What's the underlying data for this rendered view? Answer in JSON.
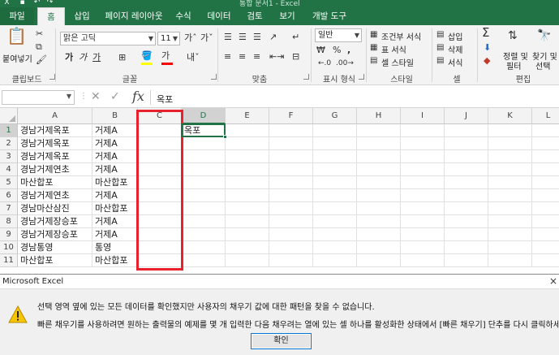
{
  "window": {
    "title": "통합 문서1 - Excel"
  },
  "tabs": [
    "파일",
    "홈",
    "삽입",
    "페이지 레이아웃",
    "수식",
    "데이터",
    "검토",
    "보기",
    "개발 도구"
  ],
  "ribbon": {
    "clipboard": {
      "paste_label": "붙여넣기",
      "group": "클립보드"
    },
    "font": {
      "name": "맑은 고딕",
      "size": "11",
      "bold": "가",
      "italic": "가",
      "underline": "가",
      "font_color": "가",
      "group": "글꼴",
      "fill_color": "#ffff00",
      "text_color": "#ff0000"
    },
    "alignment": {
      "group": "맞춤"
    },
    "number": {
      "format": "일반",
      "percent": "%",
      "comma": ",",
      "group": "표시 형식"
    },
    "styles": {
      "conditional": "조건부 서식",
      "table": "표 서식",
      "cell": "셀 스타일",
      "group": "스타일"
    },
    "cells": {
      "insert": "삽입",
      "delete": "삭제",
      "format": "서식",
      "group": "셀"
    },
    "editing": {
      "sum": "Σ",
      "sort": "정렬 및",
      "sort2": "필터",
      "find": "찾기 및",
      "find2": "선택",
      "group": "편집"
    }
  },
  "formula_bar": {
    "name_box": "",
    "fx": "fx",
    "value": "옥포"
  },
  "grid": {
    "columns": [
      "A",
      "B",
      "C",
      "D",
      "E",
      "F",
      "G",
      "H",
      "I",
      "J",
      "K",
      "L"
    ],
    "selected_column": "D",
    "rows": [
      {
        "n": "1",
        "a": "경남거제옥포",
        "b": "거제A",
        "d": "옥포"
      },
      {
        "n": "2",
        "a": "경남거제옥포",
        "b": "거제A",
        "d": ""
      },
      {
        "n": "3",
        "a": "경남거제옥포",
        "b": "거제A",
        "d": ""
      },
      {
        "n": "4",
        "a": "경남거제연초",
        "b": "거제A",
        "d": ""
      },
      {
        "n": "5",
        "a": "마산합포",
        "b": "마산합포",
        "d": ""
      },
      {
        "n": "6",
        "a": "경남거제연초",
        "b": "거제A",
        "d": ""
      },
      {
        "n": "7",
        "a": "경남마산삼진",
        "b": "마산합포",
        "d": ""
      },
      {
        "n": "8",
        "a": "경남거제장승포",
        "b": "거제A",
        "d": ""
      },
      {
        "n": "9",
        "a": "경남거제장승포",
        "b": "거제A",
        "d": ""
      },
      {
        "n": "10",
        "a": "경남통영",
        "b": "통영",
        "d": ""
      },
      {
        "n": "11",
        "a": "마산합포",
        "b": "마산합포",
        "d": ""
      }
    ]
  },
  "dialog": {
    "title": "Microsoft Excel",
    "line1": "선택 영역 옆에 있는 모든 데이터를 확인했지만 사용자의 채우기 값에 대한 패턴을 찾을 수 없습니다.",
    "line2": "빠른 채우기를 사용하려면 원하는 출력물의 예제를 몇 개 입력한 다음 채우려는 열에 있는 셀 하나를 활성화한 상태에서 [빠른 채우기] 단추를 다시 클릭하세요.",
    "ok": "확인",
    "close": "×"
  },
  "colors": {
    "accent": "#217346",
    "highlight": "#e8212c"
  }
}
